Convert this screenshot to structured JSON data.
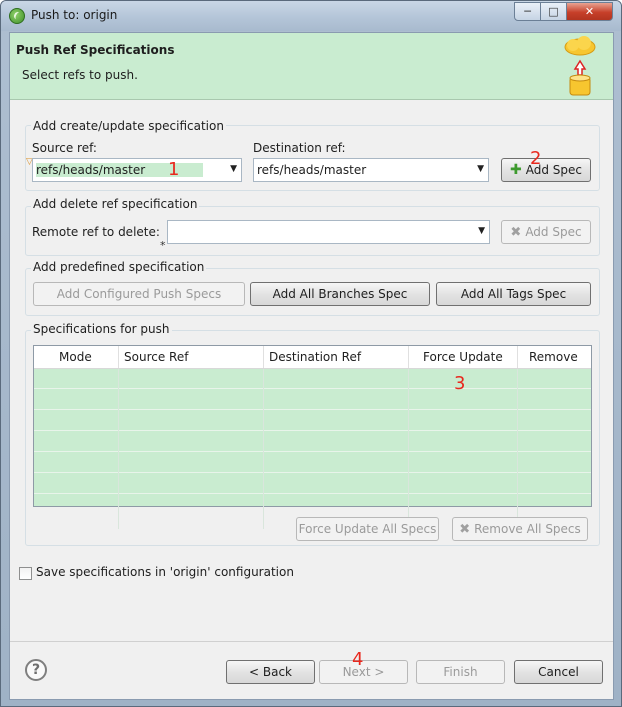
{
  "window": {
    "title": "Push to: origin"
  },
  "banner": {
    "title": "Push Ref Specifications",
    "subtitle": "Select refs to push."
  },
  "create_group": {
    "label": "Add create/update specification",
    "source_label": "Source ref:",
    "source_value": "refs/heads/master",
    "dest_label": "Destination ref:",
    "dest_value": "refs/heads/master",
    "add_spec_label": "Add Spec"
  },
  "delete_group": {
    "label": "Add delete ref specification",
    "remote_label": "Remote ref to delete:",
    "remote_value": "",
    "add_spec_label": "Add Spec"
  },
  "predefined_group": {
    "label": "Add predefined specification",
    "configured_label": "Add Configured Push Specs",
    "all_branches_label": "Add All Branches Spec",
    "all_tags_label": "Add All Tags Spec"
  },
  "specs_group": {
    "label": "Specifications for push",
    "columns": [
      "Mode",
      "Source Ref",
      "Destination Ref",
      "Force Update",
      "Remove"
    ],
    "force_all_label": "Force Update All Specs",
    "remove_all_label": "Remove All Specs"
  },
  "save_option": {
    "label": "Save specifications in 'origin' configuration",
    "checked": false
  },
  "footer": {
    "back_label": "< Back",
    "next_label": "Next >",
    "finish_label": "Finish",
    "cancel_label": "Cancel"
  },
  "annotations": [
    "1",
    "2",
    "3",
    "4"
  ],
  "icons": {
    "app": "eclipse-icon",
    "banner": "cloud-push-icon",
    "add": "plus-icon",
    "remove": "x-icon",
    "help": "help-icon",
    "dropdown": "chevron-down-icon"
  },
  "colors": {
    "banner_bg": "#c9ecd0",
    "table_rows": "#c9ecd0",
    "annotation": "#e8281e"
  }
}
